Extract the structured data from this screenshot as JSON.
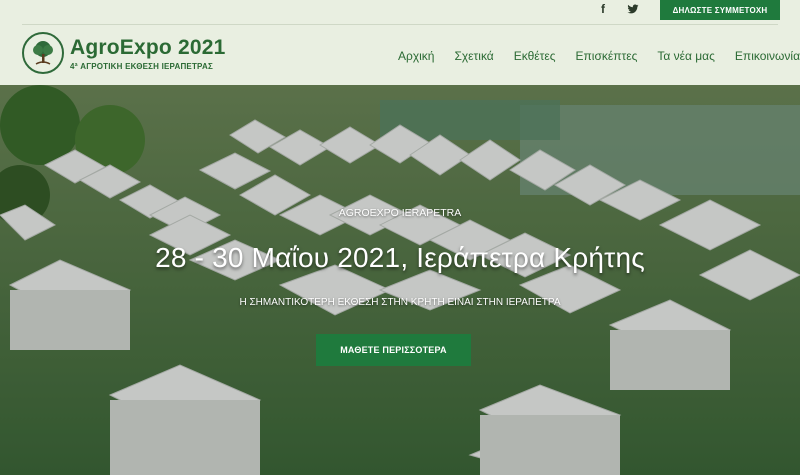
{
  "header": {
    "social": [
      "facebook-icon",
      "twitter-icon"
    ],
    "cta_top": "ΔΗΛΩΣΤΕ ΣΥΜΜΕΤΟΧΗ",
    "logo": {
      "brand": "AgroExpo 2021",
      "tagline": "4ª ΑΓΡΟΤΙΚΗ ΕΚΘΕΣΗ ΙΕΡΑΠΕΤΡΑΣ"
    },
    "nav": [
      "Αρχική",
      "Σχετικά",
      "Εκθέτες",
      "Επισκέπτες",
      "Τα νέα μας",
      "Επικοινωνία"
    ]
  },
  "hero": {
    "eyebrow": "AGROEXPO IERAPETRA",
    "headline": "28 - 30 Μαΐου 2021, Ιεράπετρα Κρήτης",
    "subline": "Η ΣΗΜΑΝΤΙΚΟΤΕΡΗ ΕΚΘΕΣΗ ΣΤΗΝ ΚΡΗΤΗ ΕΙΝΑΙ ΣΤΗΝ ΙΕΡΑΠΕΤΡΑ",
    "cta": "ΜΑΘΕΤΕ ΠΕΡΙΣΣΟΤΕΡΑ"
  },
  "colors": {
    "brand_green": "#1f7a3d",
    "header_bg": "#e9efe1",
    "text_green": "#2b6a34"
  }
}
